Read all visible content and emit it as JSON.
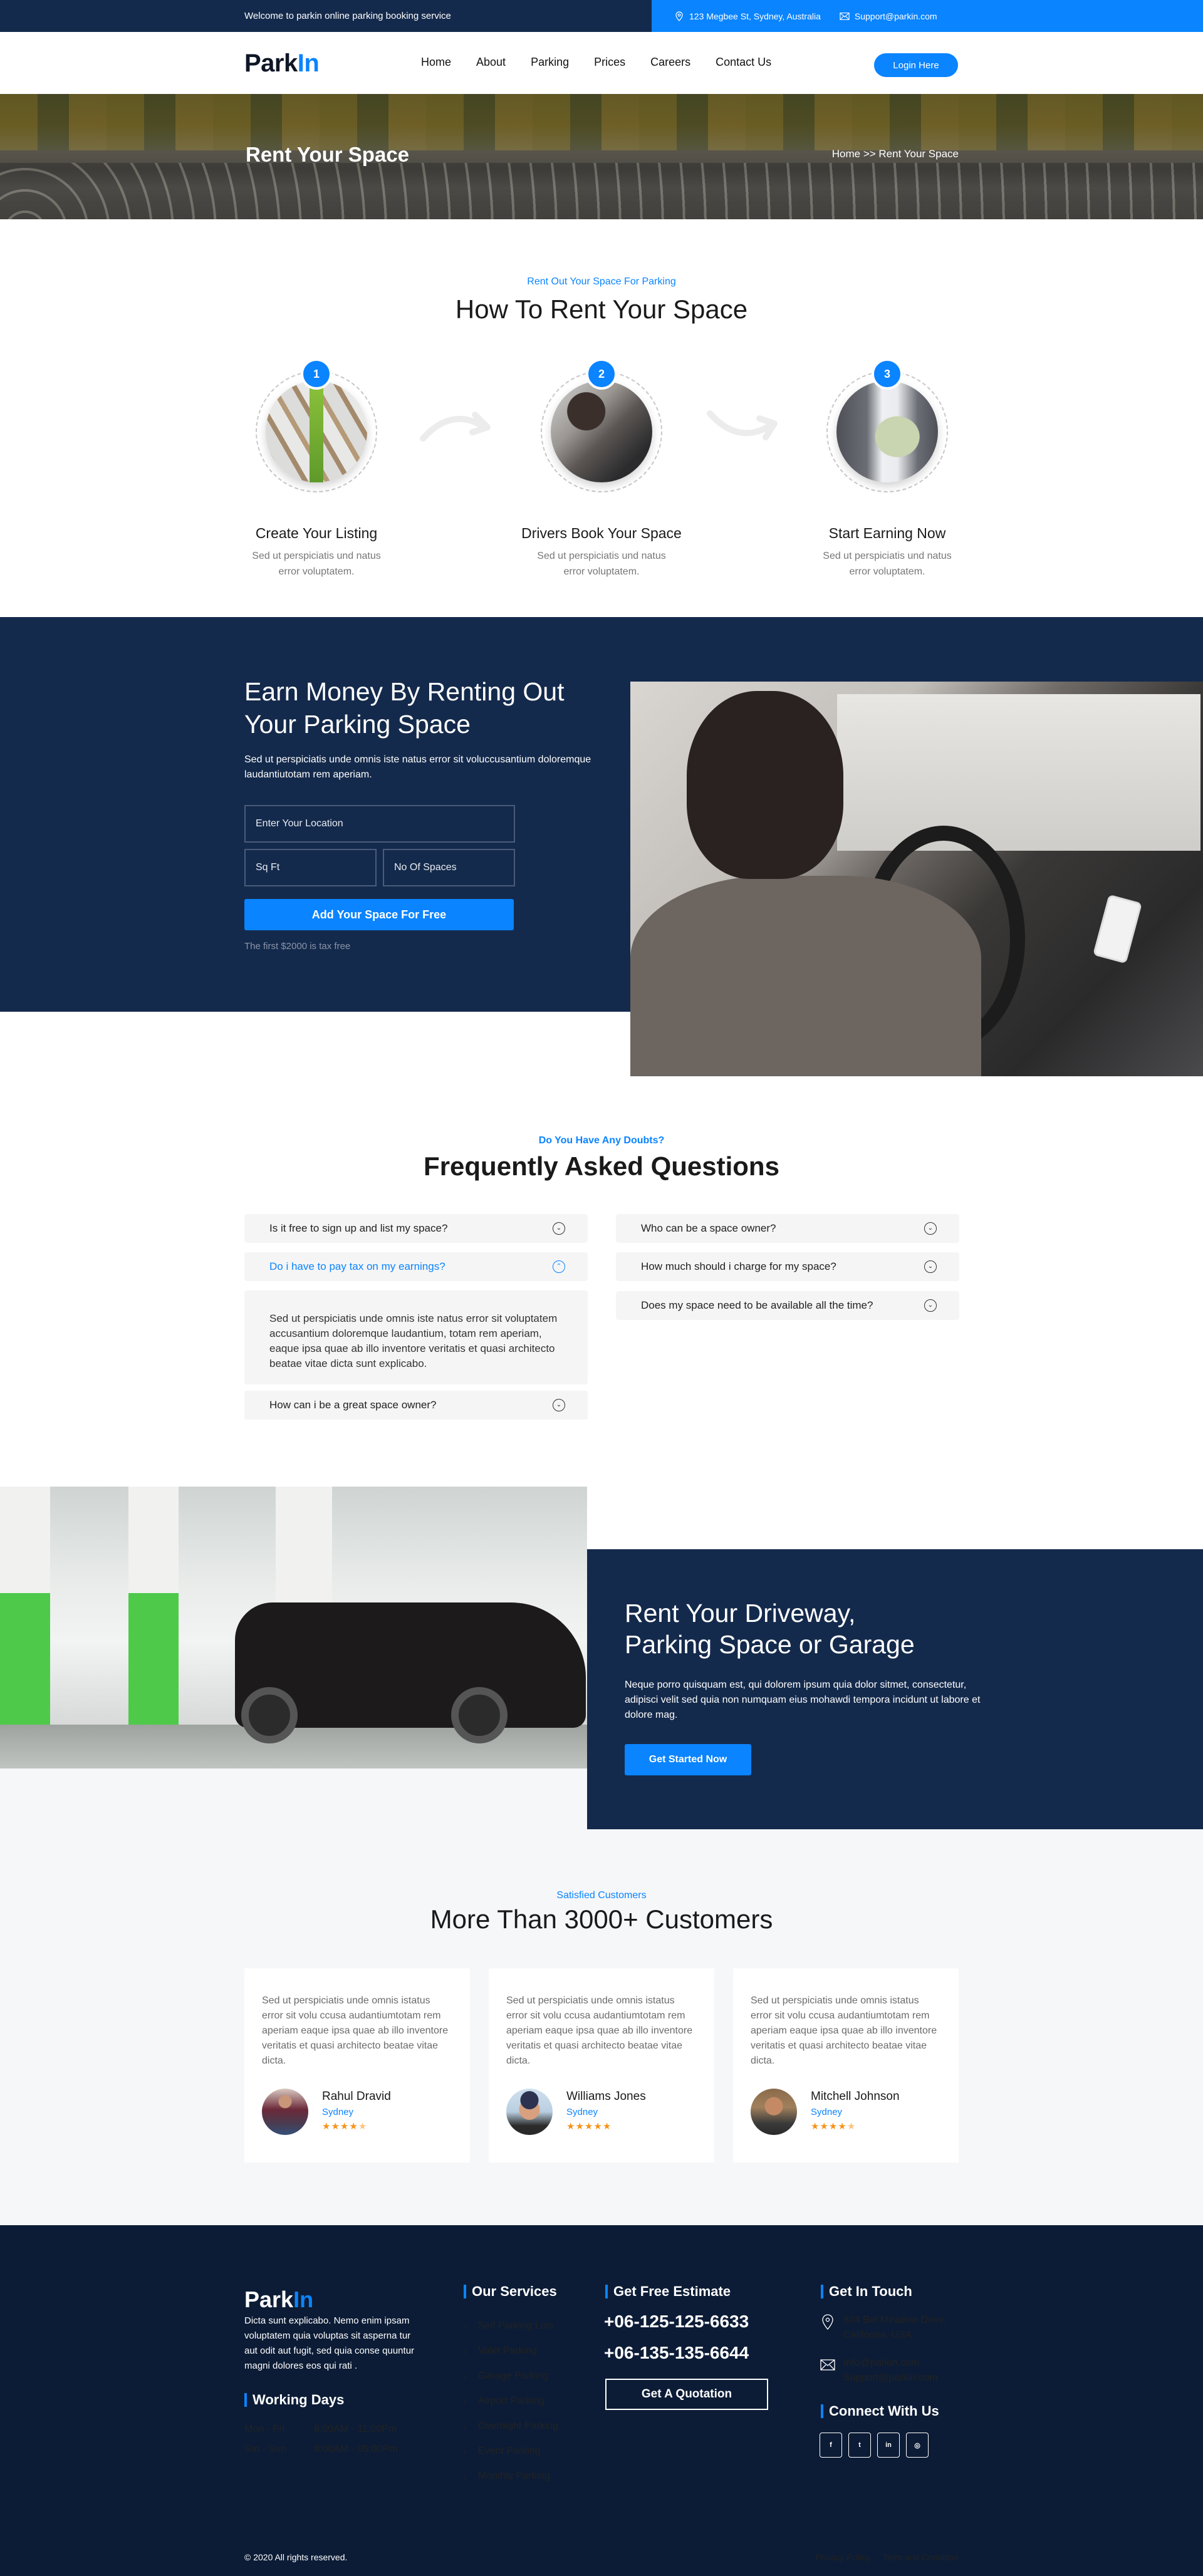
{
  "topbar": {
    "welcome": "Welcome to parkin online parking booking service",
    "address": "123 Megbee St, Sydney, Australia",
    "email": "Support@parkin.com"
  },
  "header": {
    "logo_main": "Park",
    "logo_accent": "In",
    "nav": [
      "Home",
      "About",
      "Parking",
      "Prices",
      "Careers",
      "Contact Us"
    ],
    "login_label": "Login Here"
  },
  "banner": {
    "title": "Rent Your Space",
    "breadcrumb": "Home >> Rent Your Space"
  },
  "how_to": {
    "eyebrow": "Rent Out Your Space For Parking",
    "title": "How To Rent Your Space",
    "steps": [
      {
        "num": "1",
        "title": "Create Your Listing",
        "text": "Sed ut perspiciatis und natus error voluptatem."
      },
      {
        "num": "2",
        "title": "Drivers Book Your Space",
        "text": "Sed ut perspiciatis und natus error voluptatem."
      },
      {
        "num": "3",
        "title": "Start Earning Now",
        "text": "Sed ut perspiciatis und natus error voluptatem."
      }
    ]
  },
  "earn": {
    "title": "Earn Money By Renting Out Your Parking Space",
    "description": "Sed ut perspiciatis unde omnis iste natus error sit voluccusantium doloremque laudantiutotam rem aperiam.",
    "location_placeholder": "Enter Your Location",
    "sqft_placeholder": "Sq Ft",
    "spaces_placeholder": "No Of Spaces",
    "button_label": "Add Your Space For Free",
    "note": "The first $2000 is tax free"
  },
  "faq": {
    "eyebrow": "Do You Have Any Doubts?",
    "title": "Frequently Asked Questions",
    "left": [
      {
        "q": "Is it free to sign up and list my space?",
        "open": false
      },
      {
        "q": "Do i have to pay tax on my earnings?",
        "open": true
      },
      {
        "q": "How can i be a great space owner?",
        "open": false
      }
    ],
    "answer": "Sed ut perspiciatis unde omnis iste natus error sit voluptatem accusantium doloremque laudantium, totam rem aperiam, eaque ipsa quae ab illo inventore veritatis et quasi architecto beatae vitae dicta sunt explicabo.",
    "right": [
      {
        "q": "Who can be a space owner?",
        "open": false
      },
      {
        "q": "How much should i charge for my space?",
        "open": false
      },
      {
        "q": "Does my space need to be available all the time?",
        "open": false
      }
    ]
  },
  "driveway": {
    "title_line1": "Rent Your Driveway,",
    "title_line2": "Parking Space or Garage",
    "description": "Neque porro quisquam est, qui dolorem ipsum quia dolor sitmet, consectetur, adipisci velit sed quia non numquam eius mohawdi tempora incidunt ut labore et dolore mag.",
    "button_label": "Get Started Now"
  },
  "testimonials": {
    "eyebrow": "Satisfied Customers",
    "title": "More Than 3000+ Customers",
    "items": [
      {
        "text": "Sed ut perspiciatis unde omnis istatus error sit volu ccusa audantiumtotam rem aperiam eaque ipsa quae ab illo inventore veritatis et quasi architecto beatae vitae dicta.",
        "name": "Rahul Dravid",
        "location": "Sydney",
        "rating": 4.5
      },
      {
        "text": "Sed ut perspiciatis unde omnis istatus error sit volu ccusa audantiumtotam rem aperiam eaque ipsa quae ab illo inventore veritatis et quasi architecto beatae vitae dicta.",
        "name": "Williams Jones",
        "location": "Sydney",
        "rating": 5
      },
      {
        "text": "Sed ut perspiciatis unde omnis istatus error sit volu ccusa audantiumtotam rem aperiam eaque ipsa quae ab illo inventore veritatis et quasi architecto beatae vitae dicta.",
        "name": "Mitchell Johnson",
        "location": "Sydney",
        "rating": 4.5
      }
    ]
  },
  "footer": {
    "logo_main": "Park",
    "logo_accent": "In",
    "about": "Dicta sunt explicabo. Nemo enim ipsam voluptatem quia voluptas sit asperna tur aut odit aut fugit, sed quia conse quuntur magni dolores eos qui rati .",
    "working_days_title": "Working Days",
    "hours": [
      {
        "days": "Mon - Fri",
        "time": "8:00AM - 11:00Pm"
      },
      {
        "days": "Sat - Sun",
        "time": "8:00AM - 05:00Pm"
      }
    ],
    "services_title": "Our Services",
    "services": [
      "Self Parking Lots",
      "Valet Parking",
      "Garage Parking",
      "Airport Parking",
      "Overnight Parking",
      "Event Parking",
      "Monthly Parking"
    ],
    "estimate_title": "Get Free Estimate",
    "phones": [
      "+06-125-125-6633",
      "+06-135-135-6644"
    ],
    "quote_label": "Get A Quotation",
    "touch_title": "Get In Touch",
    "address_line1": "824 Bel Meadow Drive,",
    "address_line2": "California, USA",
    "email1": "Info@parkin.com",
    "email2": "Support@parkin.com",
    "connect_title": "Connect With Us",
    "socials": [
      {
        "name": "facebook",
        "glyph": "f"
      },
      {
        "name": "twitter",
        "glyph": "t"
      },
      {
        "name": "linkedin",
        "glyph": "in"
      },
      {
        "name": "instagram",
        "glyph": "◎"
      }
    ],
    "copyright": "© 2020 All rights reserved.",
    "links": [
      "Privacy Policy",
      "Term and Condition"
    ]
  },
  "colors": {
    "accent": "#0a84ff",
    "navy": "#142a4c",
    "footer": "#0c1c36",
    "star": "#f7931a"
  }
}
